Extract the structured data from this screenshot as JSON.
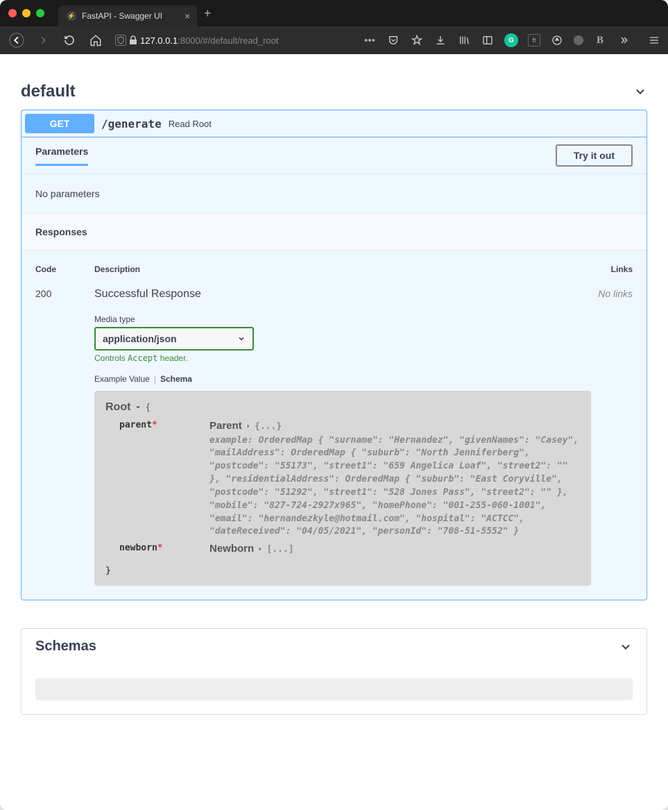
{
  "browser": {
    "tab_title": "FastAPI - Swagger UI",
    "url_host": "127.0.0.1",
    "url_rest": ":8000/#/default/read_root"
  },
  "section": {
    "title": "default"
  },
  "operation": {
    "method": "GET",
    "path": "/generate",
    "summary": "Read Root"
  },
  "params": {
    "heading": "Parameters",
    "try_label": "Try it out",
    "empty": "No parameters"
  },
  "responses": {
    "heading": "Responses",
    "columns": {
      "code": "Code",
      "desc": "Description",
      "links": "Links"
    },
    "row": {
      "code": "200",
      "desc": "Successful Response",
      "links": "No links"
    },
    "media": {
      "label": "Media type",
      "value": "application/json",
      "hint_prefix": "Controls ",
      "hint_code": "Accept",
      "hint_suffix": " header."
    },
    "tabs": {
      "example": "Example Value",
      "schema": "Schema"
    },
    "schema": {
      "root_name": "Root",
      "open_brace": "{",
      "close_brace": "}",
      "props": {
        "parent": {
          "name": "parent",
          "type": "Parent",
          "collapsed": "{...}",
          "example": "example: OrderedMap { \"surname\": \"Hernandez\", \"givenNames\": \"Casey\", \"mailAddress\": OrderedMap { \"suburb\": \"North Jenniferberg\", \"postcode\": \"55173\", \"street1\": \"659 Angelica Loaf\", \"street2\": \"\" }, \"residentialAddress\": OrderedMap { \"suburb\": \"East Coryville\", \"postcode\": \"51292\", \"street1\": \"528 Jones Pass\", \"street2\": \"\" }, \"mobile\": \"827-724-2927x965\", \"homePhone\": \"001-255-060-1001\", \"email\": \"hernandezkyle@hotmail.com\", \"hospital\": \"ACTCC\", \"dateReceived\": \"04/05/2021\", \"personId\": \"708-51-5552\" }"
        },
        "newborn": {
          "name": "newborn",
          "type": "Newborn",
          "collapsed": "[...]"
        }
      }
    }
  },
  "schemas_section": {
    "title": "Schemas"
  }
}
